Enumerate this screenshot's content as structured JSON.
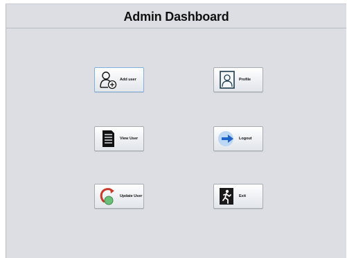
{
  "header": {
    "title": "Admin Dashboard"
  },
  "buttons": {
    "add_user": {
      "label": "Add user",
      "icon": "add-user-icon"
    },
    "profile": {
      "label": "Profile",
      "icon": "profile-icon"
    },
    "view_user": {
      "label": "View User",
      "icon": "document-list-icon"
    },
    "logout": {
      "label": "Logout",
      "icon": "logout-arrow-icon"
    },
    "update_user": {
      "label": "Update User",
      "icon": "refresh-user-icon"
    },
    "exit": {
      "label": "Exit",
      "icon": "exit-running-man-icon"
    }
  },
  "colors": {
    "background": "#dcdee3",
    "logout_arrow": "#1f64c8",
    "logout_circle": "#bcd8f4",
    "update_arrow": "#c83a2a",
    "update_ball": "#6cbf79",
    "exit_sign": "#1a1a1a"
  }
}
